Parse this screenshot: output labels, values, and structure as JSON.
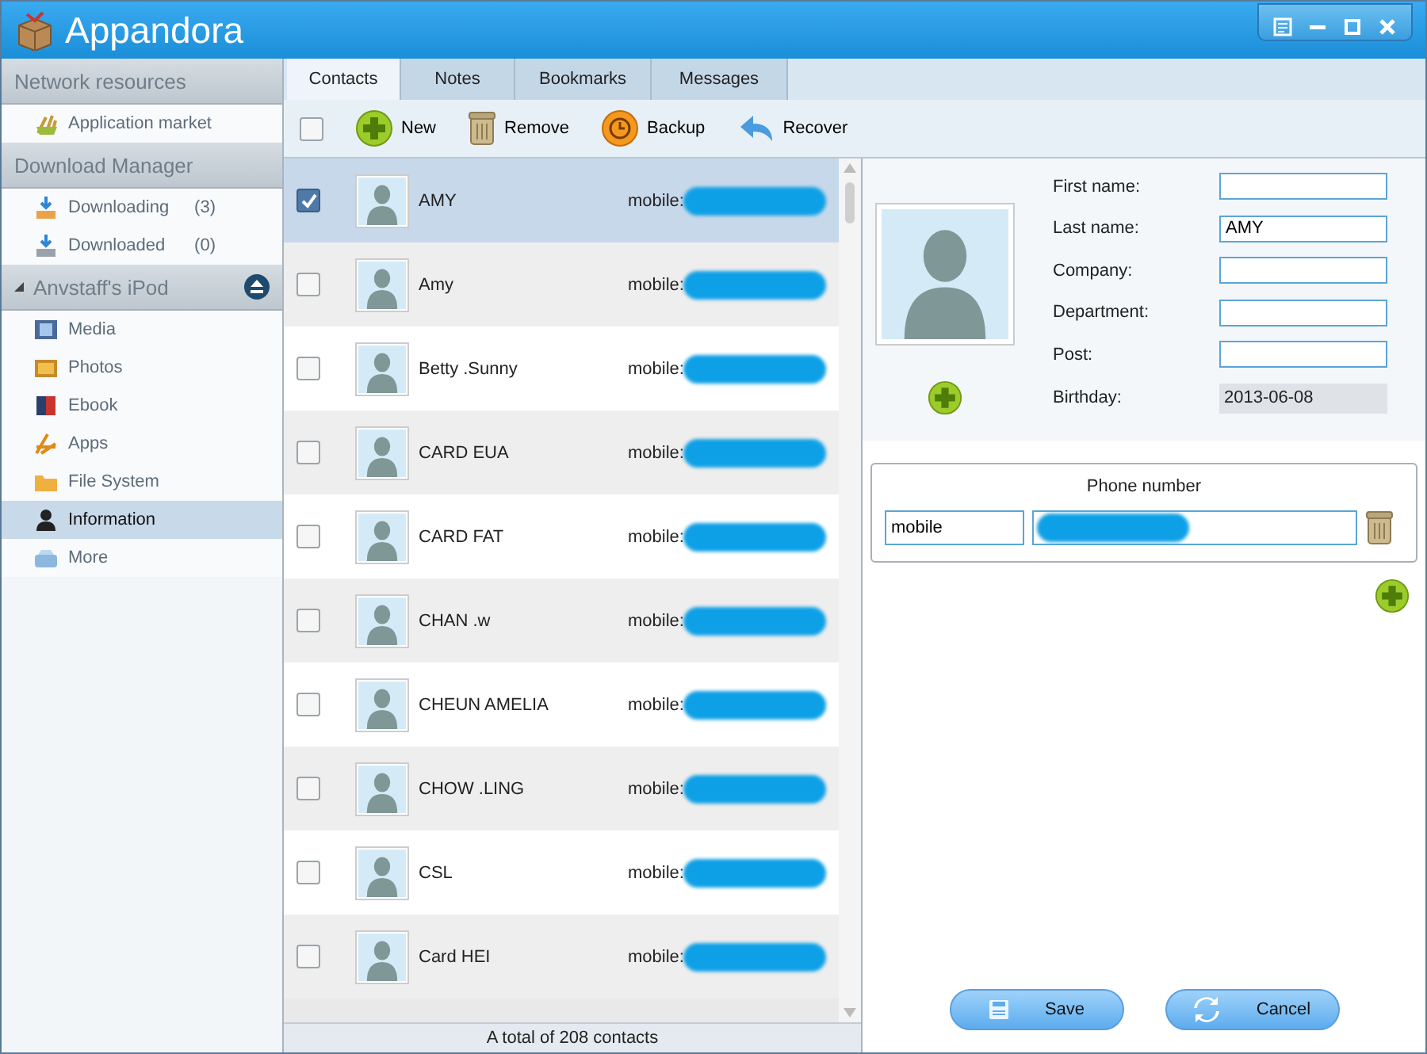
{
  "window": {
    "title": "Appandora"
  },
  "sidebar": {
    "sections": [
      {
        "title": "Network resources",
        "items": [
          {
            "label": "Application market",
            "selected": false
          }
        ]
      },
      {
        "title": "Download Manager",
        "items": [
          {
            "label": "Downloading",
            "count": "(3)",
            "selected": false
          },
          {
            "label": "Downloaded",
            "count": "(0)",
            "selected": false
          }
        ]
      },
      {
        "title": "Anvstaff's iPod",
        "kind": "device",
        "expanded": true,
        "items": [
          {
            "label": "Media",
            "selected": false
          },
          {
            "label": "Photos",
            "selected": false
          },
          {
            "label": "Ebook",
            "selected": false
          },
          {
            "label": "Apps",
            "selected": false
          },
          {
            "label": "File System",
            "selected": false
          },
          {
            "label": "Information",
            "selected": true
          },
          {
            "label": "More",
            "selected": false
          }
        ]
      }
    ]
  },
  "tabs": [
    {
      "label": "Contacts",
      "selected": true
    },
    {
      "label": "Notes",
      "selected": false
    },
    {
      "label": "Bookmarks",
      "selected": false
    },
    {
      "label": "Messages",
      "selected": false
    }
  ],
  "toolbar": {
    "select_all": {
      "checked": false
    },
    "buttons": [
      "New",
      "Remove",
      "Backup",
      "Recover"
    ]
  },
  "contacts": [
    {
      "name": "AMY",
      "phone_label": "mobile:",
      "checked": true,
      "selected": true
    },
    {
      "name": "Amy",
      "phone_label": "mobile:",
      "checked": false,
      "selected": false
    },
    {
      "name": "Betty .Sunny",
      "phone_label": "mobile:",
      "checked": false,
      "selected": false
    },
    {
      "name": "CARD EUA",
      "phone_label": "mobile:",
      "checked": false,
      "selected": false
    },
    {
      "name": "CARD FAT",
      "phone_label": "mobile:",
      "checked": false,
      "selected": false
    },
    {
      "name": "CHAN .w",
      "phone_label": "mobile:",
      "checked": false,
      "selected": false
    },
    {
      "name": "CHEUN AMELIA",
      "phone_label": "mobile:",
      "checked": false,
      "selected": false
    },
    {
      "name": "CHOW .LING",
      "phone_label": "mobile:",
      "checked": false,
      "selected": false
    },
    {
      "name": "CSL",
      "phone_label": "mobile:",
      "checked": false,
      "selected": false
    },
    {
      "name": "Card HEI",
      "phone_label": "mobile:",
      "checked": false,
      "selected": false
    }
  ],
  "status_bar": "A total of 208 contacts",
  "detail": {
    "fields": [
      {
        "label": "First name:",
        "kind": "input"
      },
      {
        "label": "Last name:",
        "value": "AMY",
        "kind": "input"
      },
      {
        "label": "Company:",
        "kind": "input"
      },
      {
        "label": "Department:",
        "kind": "input"
      },
      {
        "label": "Post:",
        "kind": "input"
      },
      {
        "label": "Birthday:",
        "value": "2013-06-08",
        "kind": "readonly"
      }
    ],
    "phone_section": {
      "title": "Phone number",
      "entries": [
        {
          "type": "mobile"
        }
      ]
    },
    "buttons": [
      "Save",
      "Cancel"
    ]
  }
}
